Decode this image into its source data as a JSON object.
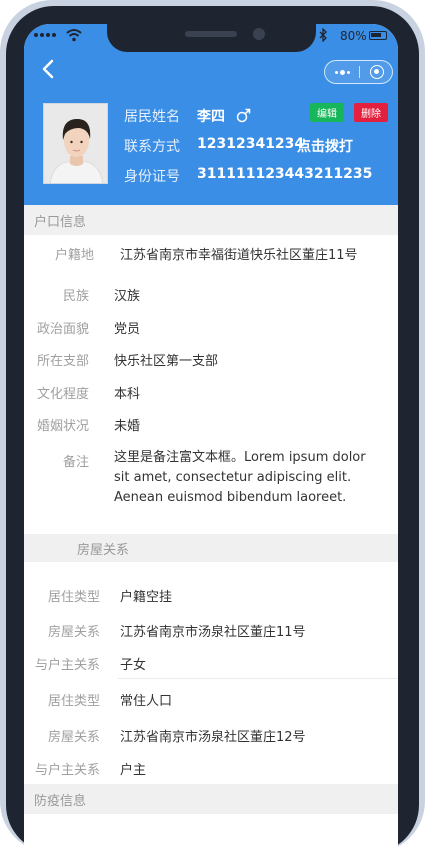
{
  "status_bar": {
    "battery": "80%"
  },
  "profile": {
    "name_label": "居民姓名",
    "name": "李四",
    "gender_symbol": "♂",
    "phone_label": "联系方式",
    "phone": "12312341234",
    "call_action": "点击拨打",
    "id_label": "身份证号",
    "id_number": "311111123443211235",
    "edit_label": "编辑",
    "delete_label": "删除"
  },
  "household": {
    "title": "户口信息",
    "fields": [
      {
        "label": "户籍地",
        "value": "江苏省南京市幸福街道快乐社区董庄11号"
      },
      {
        "label": "民族",
        "value": "汉族"
      },
      {
        "label": "政治面貌",
        "value": "党员"
      },
      {
        "label": "所在支部",
        "value": "快乐社区第一支部"
      },
      {
        "label": "文化程度",
        "value": "本科"
      },
      {
        "label": "婚姻状况",
        "value": "未婚"
      }
    ],
    "remark_label": "备注",
    "remark": "这里是备注富文本框。Lorem ipsum dolor sit amet, consectetur adipiscing elit. Aenean euismod bibendum laoreet."
  },
  "housing": {
    "title": "房屋关系",
    "records": [
      {
        "type_label": "居住类型",
        "type": "户籍空挂",
        "house_label": "房屋关系",
        "house": "江苏省南京市汤泉社区董庄11号",
        "relation_label": "与户主关系",
        "relation": "子女"
      },
      {
        "type_label": "居住类型",
        "type": "常住人口",
        "house_label": "房屋关系",
        "house": "江苏省南京市汤泉社区董庄12号",
        "relation_label": "与户主关系",
        "relation": "户主"
      }
    ]
  },
  "epidemic": {
    "title": "防疫信息"
  },
  "colors": {
    "header_blue": "#3a8ee6",
    "edit_green": "#18b65a",
    "delete_red": "#e4203f",
    "section_bg": "#f0f0f0"
  },
  "icons": {
    "back": "chevron-left-icon",
    "more": "more-dots-icon",
    "close": "target-close-icon",
    "gender": "male-icon"
  }
}
